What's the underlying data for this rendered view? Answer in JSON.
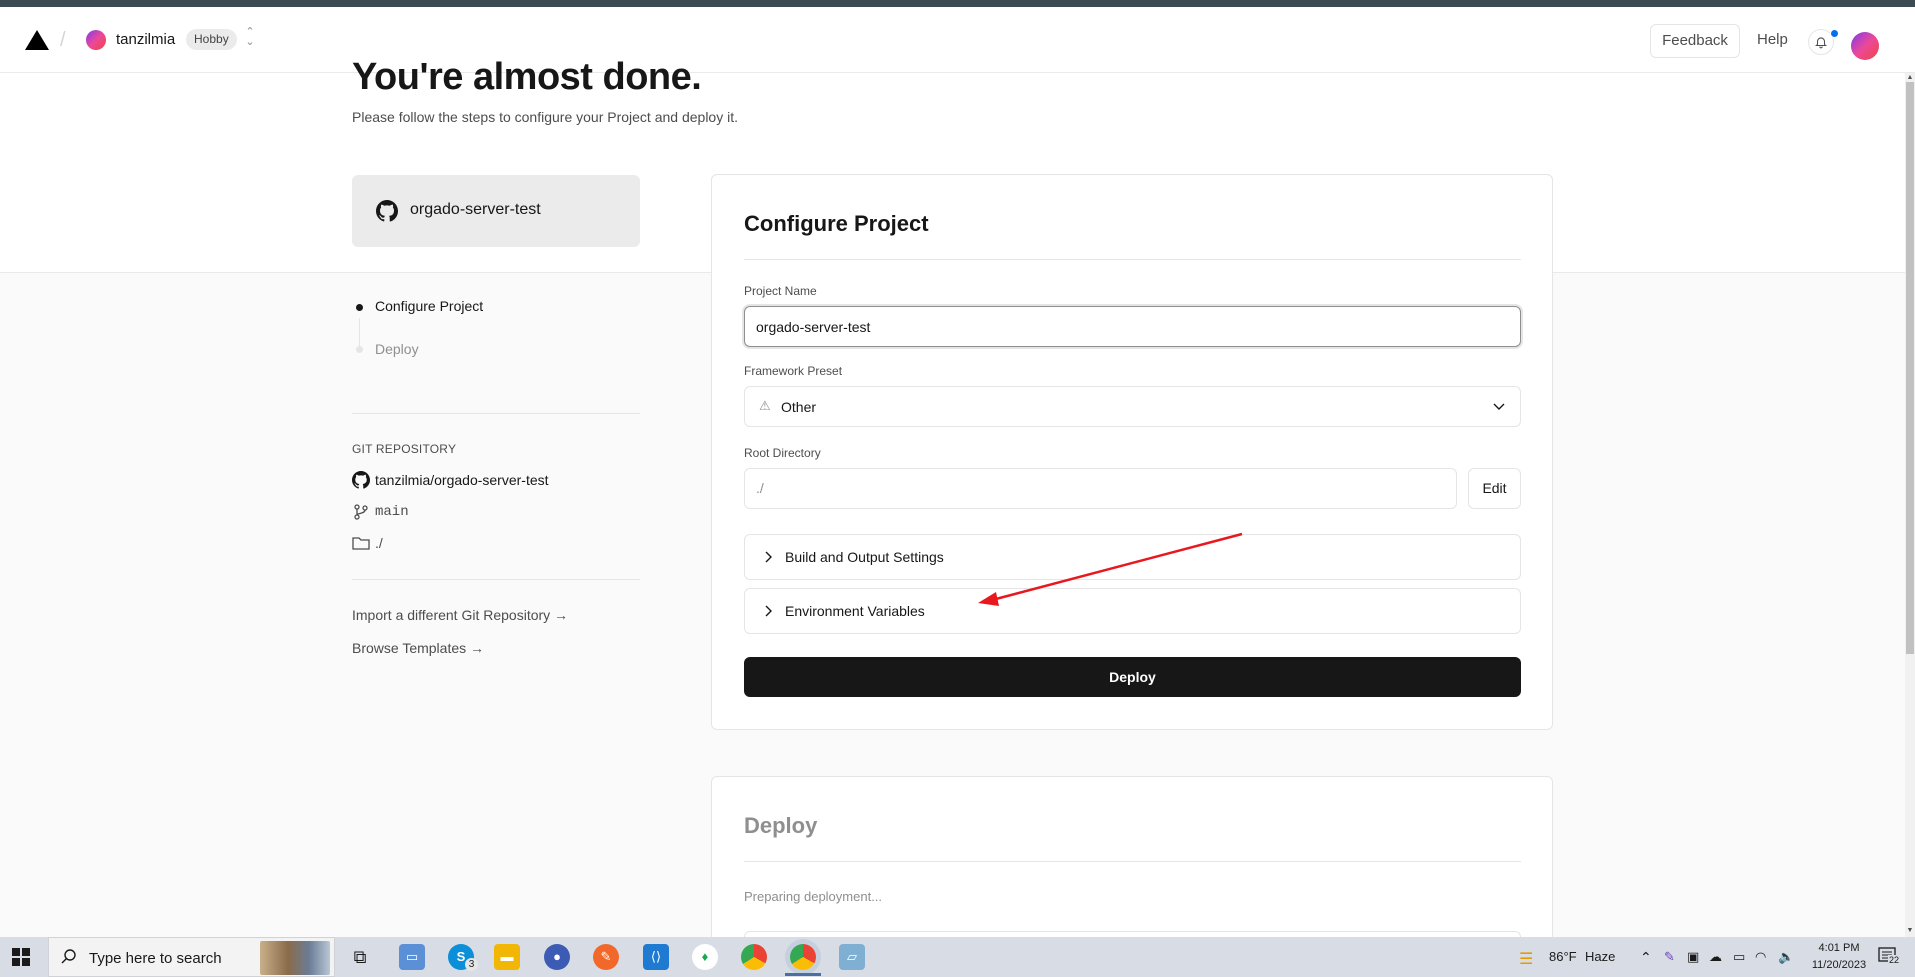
{
  "header": {
    "team_name": "tanzilmia",
    "plan_badge": "Hobby",
    "feedback_label": "Feedback",
    "help_label": "Help"
  },
  "hero": {
    "title": "You're almost done.",
    "subtitle": "Please follow the steps to configure your Project and deploy it."
  },
  "sidebar": {
    "repo_card_name": "orgado-server-test",
    "steps": [
      {
        "label": "Configure Project",
        "state": "active"
      },
      {
        "label": "Deploy",
        "state": "pending"
      }
    ],
    "git_heading": "GIT REPOSITORY",
    "git_repo": "tanzilmia/orgado-server-test",
    "git_branch": "main",
    "git_dir": "./",
    "import_link": "Import a different Git Repository →",
    "browse_link": "Browse Templates →"
  },
  "configure": {
    "title": "Configure Project",
    "project_name_label": "Project Name",
    "project_name_value": "orgado-server-test",
    "framework_label": "Framework Preset",
    "framework_value": "Other",
    "root_dir_label": "Root Directory",
    "root_dir_value": "./",
    "edit_label": "Edit",
    "build_settings_label": "Build and Output Settings",
    "env_vars_label": "Environment Variables",
    "deploy_label": "Deploy"
  },
  "deploy_section": {
    "title": "Deploy",
    "status": "Preparing deployment..."
  },
  "annotation": {
    "arrow_color": "#e8181e"
  },
  "taskbar": {
    "search_placeholder": "Type here to search",
    "skype_badge": "3",
    "weather_temp": "86°F",
    "weather_desc": "Haze",
    "time": "4:01 PM",
    "date": "11/20/2023",
    "notif_count": "22"
  }
}
